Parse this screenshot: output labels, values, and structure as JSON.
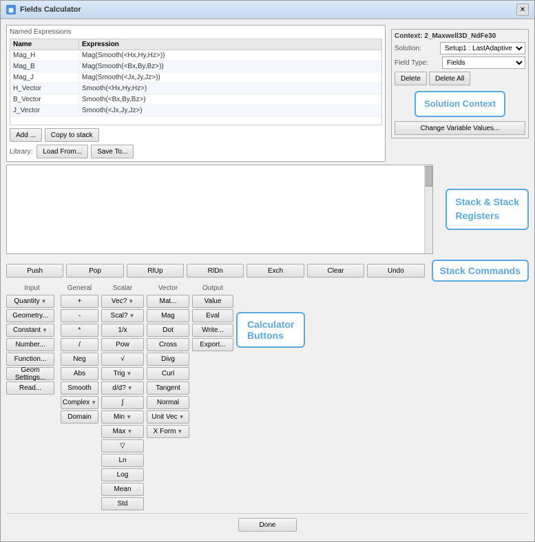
{
  "window": {
    "title": "Fields Calculator",
    "icon": "📊"
  },
  "named_expressions": {
    "panel_title": "Named Expressions",
    "columns": [
      "Name",
      "Expression"
    ],
    "rows": [
      {
        "name": "Mag_H",
        "expression": "Mag(Smooth(<Hx,Hy,Hz>))"
      },
      {
        "name": "Mag_B",
        "expression": "Mag(Smooth(<Bx,By,Bz>))"
      },
      {
        "name": "Mag_J",
        "expression": "Mag(Smooth(<Jx,Jy,Jz>))"
      },
      {
        "name": "H_Vector",
        "expression": "Smooth(<Hx,Hy,Hz>)"
      },
      {
        "name": "B_Vector",
        "expression": "Smooth(<Bx,By,Bz>)"
      },
      {
        "name": "J_Vector",
        "expression": "Smooth(<Jx,Jy,Jz>)"
      }
    ],
    "add_btn": "Add ...",
    "copy_to_stack_btn": "Copy to stack",
    "delete_btn": "Delete",
    "delete_all_btn": "Delete All",
    "library_label": "Library:",
    "load_from_btn": "Load From...",
    "save_to_btn": "Save To..."
  },
  "context": {
    "title": "Context: 2_Maxwell3D_NdFe30",
    "solution_label": "Solution:",
    "solution_value": "Setup1 : LastAdaptive",
    "field_type_label": "Field Type:",
    "field_type_value": "Fields",
    "change_variable_btn": "Change Variable Values..."
  },
  "stack_commands": {
    "push": "Push",
    "pop": "Pop",
    "rlup": "RlUp",
    "rldn": "RlDn",
    "exch": "Exch",
    "clear": "Clear",
    "undo": "Undo"
  },
  "calculator": {
    "input_header": "Input",
    "general_header": "General",
    "scalar_header": "Scalar",
    "vector_header": "Vector",
    "output_header": "Output",
    "input_buttons": [
      "Quantity ▼",
      "Geometry...",
      "Constant ▼",
      "Number...",
      "Function...",
      "Geom Settings...",
      "Read..."
    ],
    "general_buttons": [
      "+",
      "-",
      "*",
      "/",
      "Neg",
      "Abs",
      "Smooth",
      "Complex ▼",
      "Domain"
    ],
    "scalar_buttons": [
      "Vec? ▼",
      "Scal? ▼",
      "1/x",
      "Mat...",
      "Pow",
      "Mag",
      "√",
      "Dot",
      "Trig ▼",
      "Cross",
      "d/d? ▼",
      "Divg",
      "∫",
      "Curl",
      "Min ▼",
      "Tangent",
      "Max ▼",
      "Normal",
      "▽",
      "Unit Vec ▼",
      "Ln",
      "X Form ▼",
      "Log",
      "Mean",
      "Std"
    ],
    "output_buttons": [
      "Value",
      "Eval",
      "Write...",
      "Export..."
    ]
  },
  "annotations": {
    "named_expressions": "Named\nExpressions",
    "solution_context": "Solution Context",
    "stack_registers": "Stack & Stack\nRegisters",
    "stack_commands": "Stack Commands",
    "calculator_buttons": "Calculator\nButtons"
  },
  "done_btn": "Done"
}
